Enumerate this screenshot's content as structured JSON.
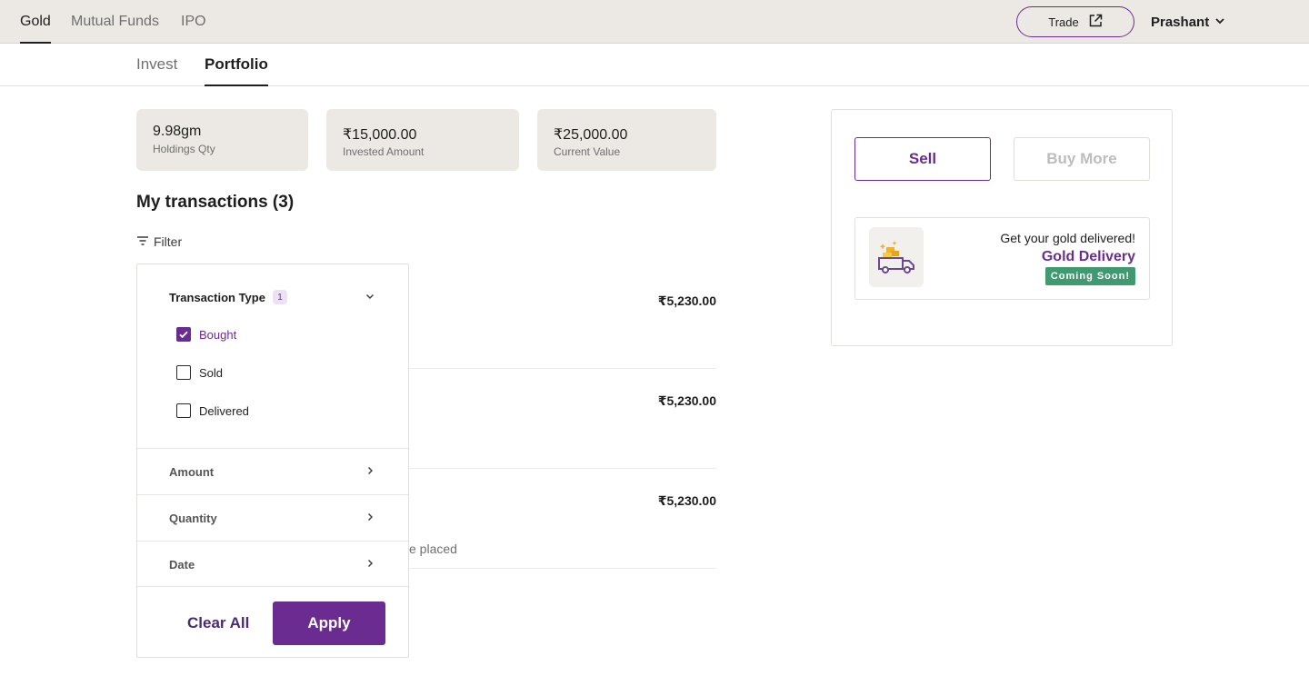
{
  "top_nav": {
    "tabs": [
      {
        "label": "Gold",
        "active": true
      },
      {
        "label": "Mutual Funds",
        "active": false
      },
      {
        "label": "IPO",
        "active": false
      }
    ],
    "trade_label": "Trade",
    "user_name": "Prashant"
  },
  "sub_nav": {
    "tabs": [
      {
        "label": "Invest",
        "active": false
      },
      {
        "label": "Portfolio",
        "active": true
      }
    ]
  },
  "stats": [
    {
      "value": "9.98gm",
      "label": "Holdings Qty"
    },
    {
      "value": "₹15,000.00",
      "label": "Invested Amount"
    },
    {
      "value": "₹25,000.00",
      "label": "Current Value"
    }
  ],
  "transactions": {
    "title": "My transactions (3)",
    "filter_label": "Filter",
    "items": [
      {
        "amount": "₹5,230.00"
      },
      {
        "amount": "₹5,230.00"
      },
      {
        "amount": "₹5,230.00",
        "note": "e placed"
      }
    ]
  },
  "filter_panel": {
    "transaction_type": {
      "title": "Transaction Type",
      "count": "1",
      "options": [
        {
          "label": "Bought",
          "checked": true
        },
        {
          "label": "Sold",
          "checked": false
        },
        {
          "label": "Delivered",
          "checked": false
        }
      ]
    },
    "sections": [
      "Amount",
      "Quantity",
      "Date"
    ],
    "clear_label": "Clear All",
    "apply_label": "Apply"
  },
  "actions": {
    "sell_label": "Sell",
    "buy_more_label": "Buy More"
  },
  "delivery": {
    "headline": "Get your gold delivered!",
    "title": "Gold Delivery",
    "badge": "Coming Soon!"
  },
  "colors": {
    "brand": "#6a2c91",
    "badge_green": "#3f9a6f",
    "nav_bg": "#ece9e5"
  }
}
